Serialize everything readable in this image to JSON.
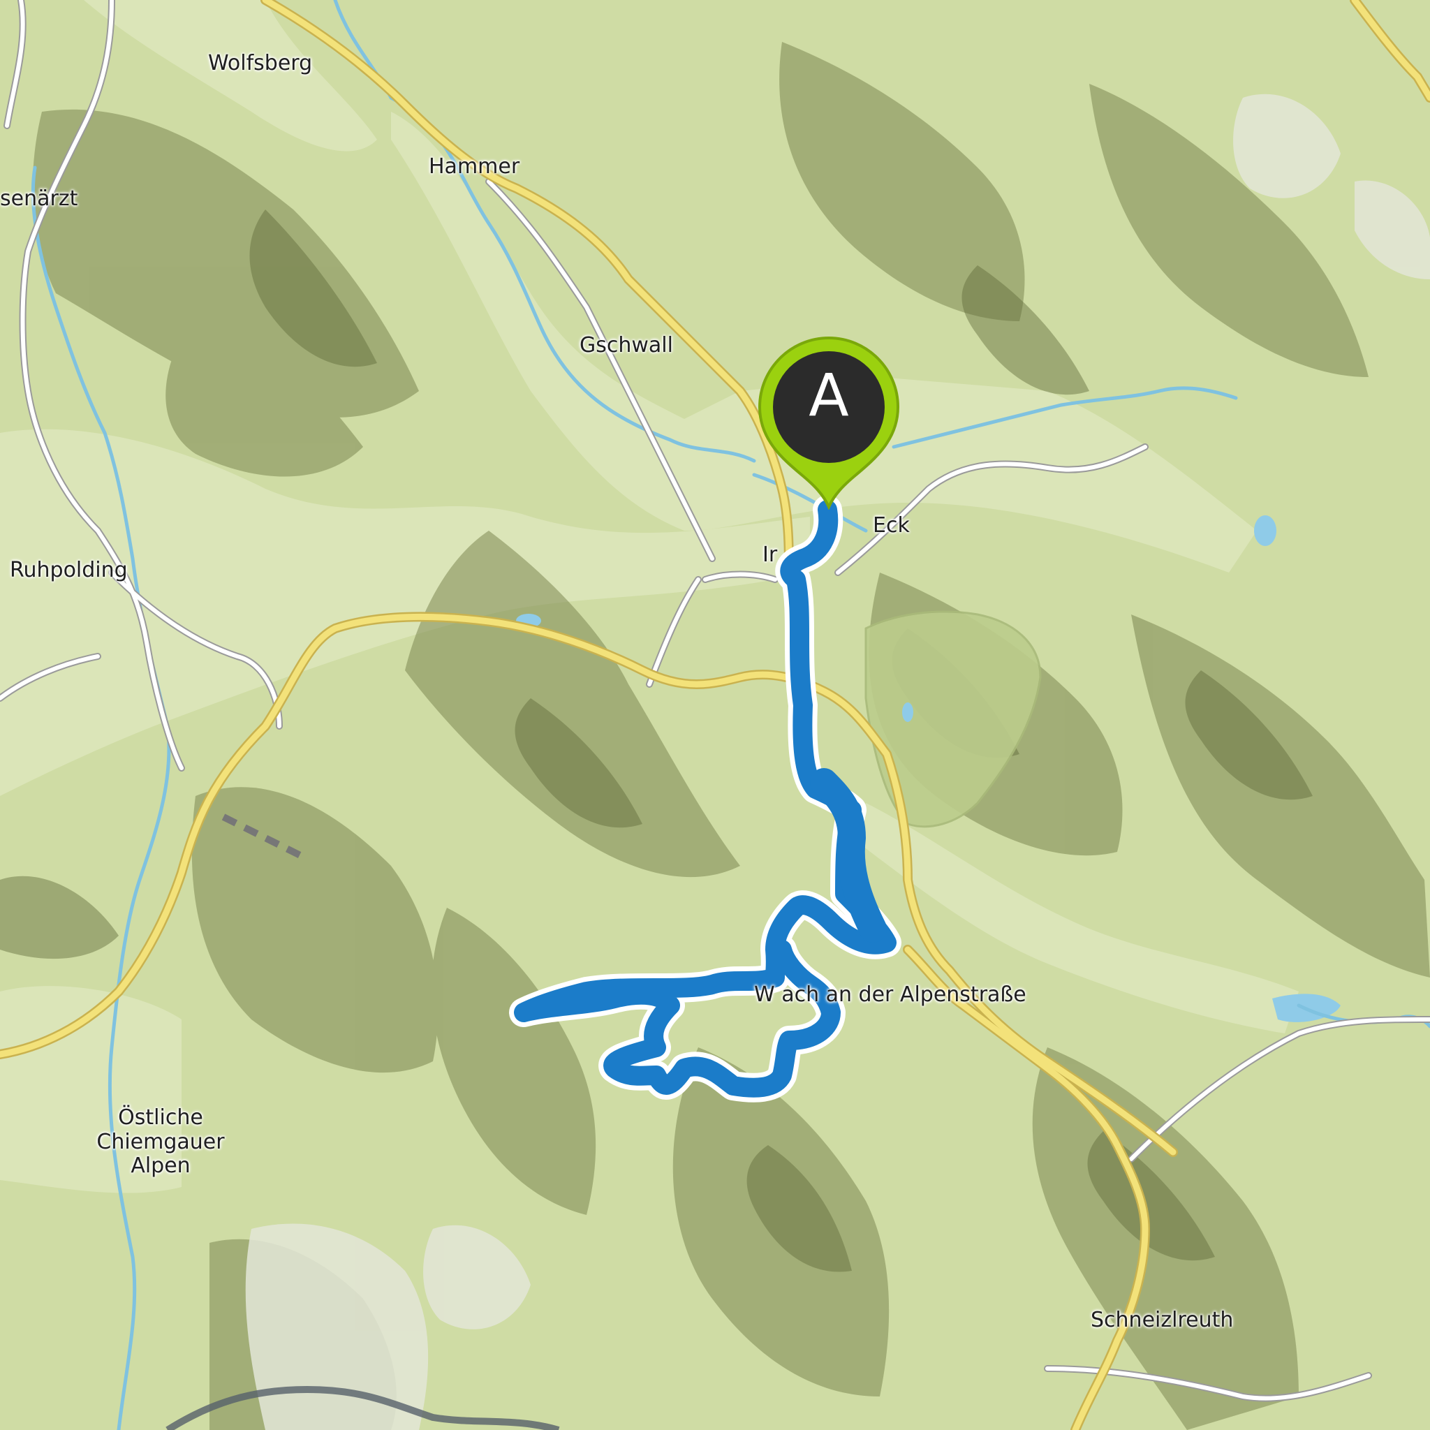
{
  "map": {
    "style": "topographic",
    "colors": {
      "terrain_base": "#cfdca4",
      "terrain_shadow": "#6f7a48",
      "forest_area": "#bfd08e",
      "main_road": "#f3e27a",
      "road_casing": "#c9b24f",
      "minor_road": "#ffffff",
      "river": "#7fc2e0",
      "route": "#1b7cc9",
      "route_casing": "#ffffff",
      "marker_fill": "#9bd10f",
      "marker_center": "#2b2b2b",
      "border": "#56606a"
    },
    "labels": {
      "wolfsberg": "Wolfsberg",
      "hammer": "Hammer",
      "senarzt": "senärzt",
      "gschwall": "Gschwall",
      "eck": "Eck",
      "ir": "Ir",
      "ruhpolding": "Ruhpolding",
      "weissbach": "W      ach an der Alpenstraße",
      "oestliche": "Östliche",
      "chiemgauer": "Chiemgauer",
      "alpen": "Alpen",
      "schneizlreuth": "Schneizlreuth"
    },
    "route": {
      "start_marker_label": "A",
      "icon": "map-pin-icon"
    }
  }
}
